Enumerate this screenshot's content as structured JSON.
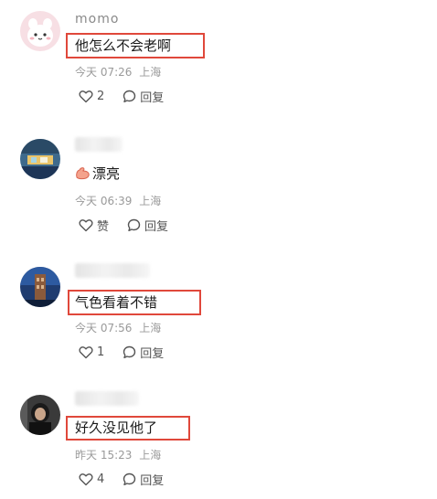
{
  "comments": [
    {
      "username": "momo",
      "text": "他怎么不会老啊",
      "time": "今天 07:26",
      "location": "上海",
      "like_label": "2",
      "reply_label": "回复"
    },
    {
      "username": "",
      "text": "漂亮",
      "time": "今天 06:39",
      "location": "上海",
      "like_label": "赞",
      "reply_label": "回复"
    },
    {
      "username": "",
      "text": "气色看着不错",
      "time": "今天 07:56",
      "location": "上海",
      "like_label": "1",
      "reply_label": "回复"
    },
    {
      "username": "",
      "text": "好久没见他了",
      "time": "昨天 15:23",
      "location": "上海",
      "like_label": "4",
      "reply_label": "回复"
    }
  ],
  "colors": {
    "highlight_border": "#e0483b",
    "meta_text": "#9a9a9a",
    "username_text": "#8a8a8a"
  },
  "icons": {
    "like": "heart-outline-icon",
    "reply": "speech-bubble-icon",
    "emoji": "strong-arm-emoji-icon"
  }
}
